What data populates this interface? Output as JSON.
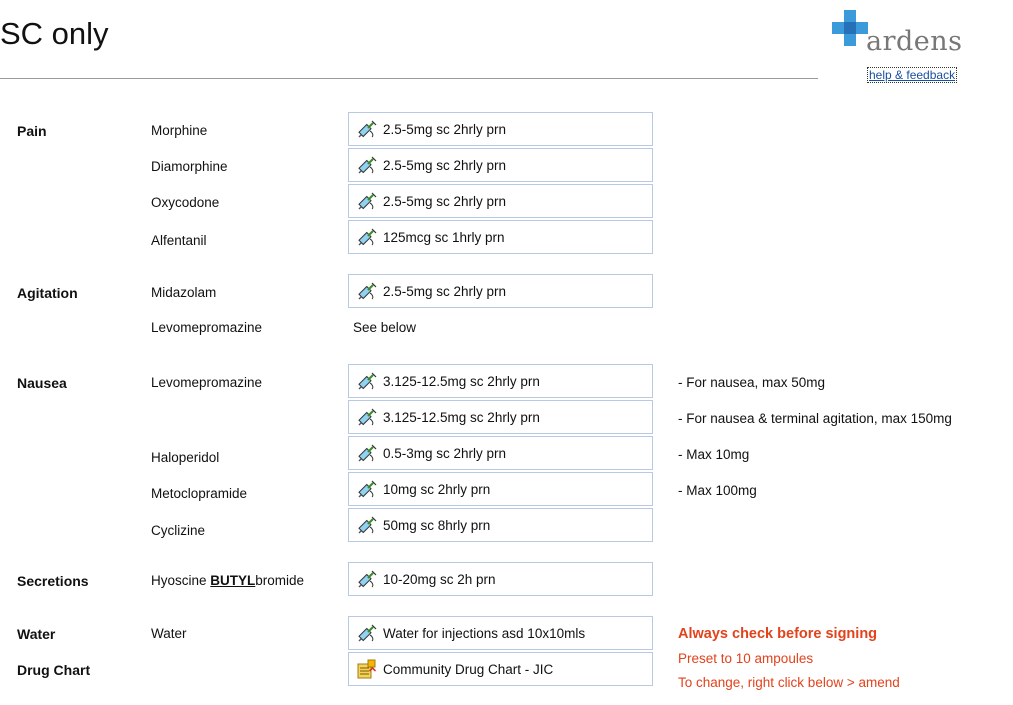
{
  "page": {
    "title": "SC only"
  },
  "header": {
    "logo_text": "ardens",
    "help_link": "help & feedback"
  },
  "colors": {
    "accent": "#2e86c8",
    "warning": "#e2421c",
    "box_border": "#b7c9e3"
  },
  "sections": {
    "pain": {
      "label": "Pain",
      "drugs": [
        "Morphine",
        "Diamorphine",
        "Oxycodone",
        "Alfentanil"
      ],
      "doses": [
        "2.5-5mg sc 2hrly prn",
        "2.5-5mg sc 2hrly prn",
        "2.5-5mg sc 2hrly prn",
        "125mcg sc 1hrly prn"
      ]
    },
    "agitation": {
      "label": "Agitation",
      "drugs": [
        "Midazolam",
        "Levomepromazine"
      ],
      "doses": [
        "2.5-5mg sc 2hrly prn"
      ],
      "see_below": "See below"
    },
    "nausea": {
      "label": "Nausea",
      "drugs": [
        "Levomepromazine",
        "Haloperidol",
        "Metoclopramide",
        "Cyclizine"
      ],
      "doses": [
        "3.125-12.5mg sc 2hrly prn",
        "3.125-12.5mg sc 2hrly prn",
        "0.5-3mg sc 2hrly prn",
        "10mg sc 2hrly prn",
        "50mg sc 8hrly prn"
      ],
      "notes": [
        "- For nausea, max 50mg",
        "- For nausea & terminal agitation, max 150mg",
        "- Max 10mg",
        "- Max 100mg"
      ]
    },
    "secretions": {
      "label": "Secretions",
      "drug_prefix": "Hyoscine ",
      "drug_emphasis": "BUTYL",
      "drug_suffix": "bromide",
      "dose": "10-20mg sc 2h prn"
    },
    "water": {
      "label": "Water",
      "drug": "Water",
      "dose": "Water for injections asd 10x10mls"
    },
    "drug_chart": {
      "label": "Drug Chart",
      "item": "Community Drug Chart - JIC"
    }
  },
  "warnings": {
    "check": "Always check before signing",
    "preset": "Preset to 10 ampoules",
    "change": "To change, right click below > amend"
  },
  "icons": {
    "dose": "syringe-icon",
    "chart": "document-icon",
    "logo": "plus-cross-icon"
  }
}
